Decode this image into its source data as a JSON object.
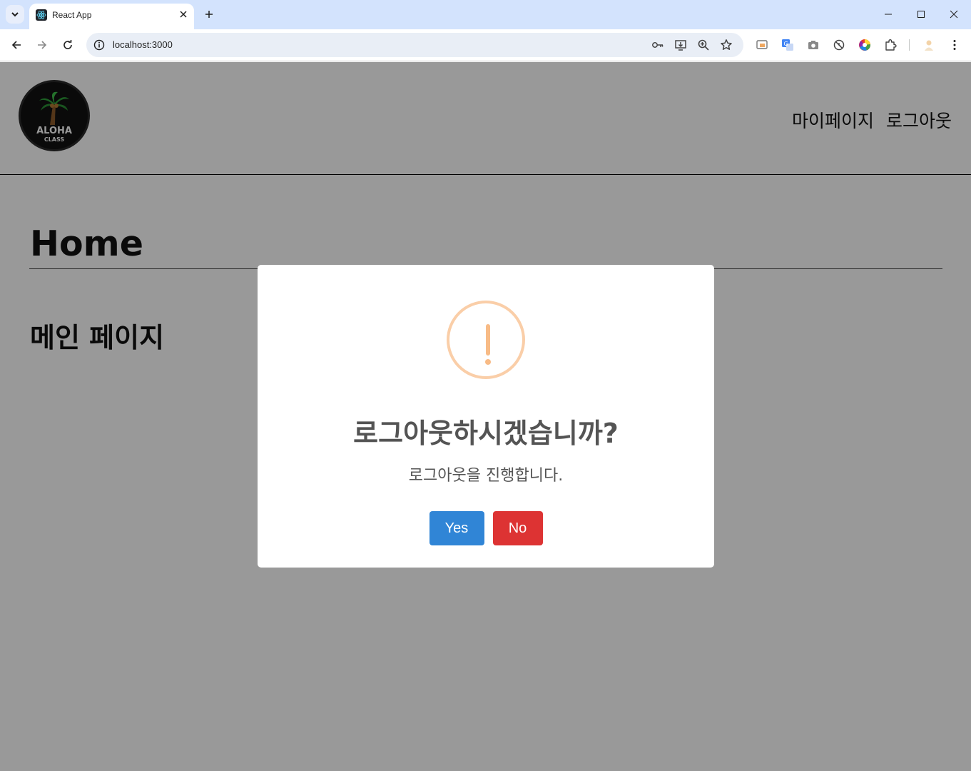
{
  "browser": {
    "tab_title": "React App",
    "url": "localhost:3000"
  },
  "colors": {
    "tabstrip": "#d3e3fd",
    "omnibox": "#e9eef6",
    "overlay": "rgba(0,0,0,0.4)",
    "yes_button": "#3085d6",
    "no_button": "#dd3333",
    "warning": "#f8bb86"
  },
  "header": {
    "logo_line1": "ALOHA",
    "logo_line2": "CLASS",
    "nav": [
      "마이페이지",
      "로그아웃"
    ]
  },
  "main": {
    "title": "Home",
    "subtitle": "메인 페이지"
  },
  "modal": {
    "icon": "warning-icon",
    "icon_glyph": "!",
    "title": "로그아웃하시겠습니까?",
    "text": "로그아웃을 진행합니다.",
    "confirm_label": "Yes",
    "cancel_label": "No"
  }
}
